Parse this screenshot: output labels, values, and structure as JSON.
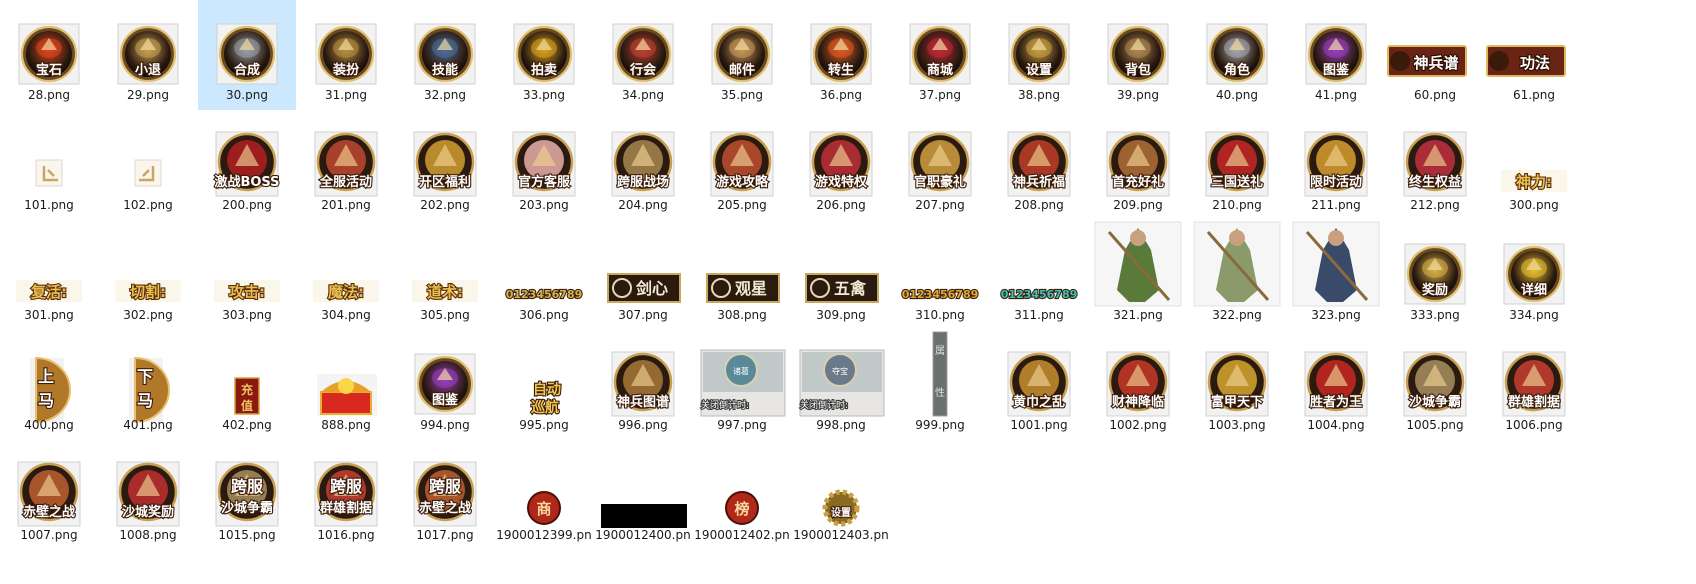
{
  "files": [
    {
      "name": "28.png",
      "kind": "round",
      "label": "宝石",
      "icon": "gem-flame-icon",
      "accent": "#e0461c"
    },
    {
      "name": "29.png",
      "kind": "round",
      "label": "小退",
      "icon": "hourglass-icon",
      "accent": "#c8a050"
    },
    {
      "name": "30.png",
      "kind": "round",
      "label": "合成",
      "icon": "anvil-hammer-icon",
      "accent": "#9aa0a8",
      "selected": true
    },
    {
      "name": "31.png",
      "kind": "round",
      "label": "装扮",
      "icon": "armor-icon",
      "accent": "#b89040"
    },
    {
      "name": "32.png",
      "kind": "round",
      "label": "技能",
      "icon": "skill-book-icon",
      "accent": "#4f6e9a"
    },
    {
      "name": "33.png",
      "kind": "round",
      "label": "拍卖",
      "icon": "auction-hammer-icon",
      "accent": "#d8a020"
    },
    {
      "name": "34.png",
      "kind": "round",
      "label": "行会",
      "icon": "guild-crest-icon",
      "accent": "#c04030"
    },
    {
      "name": "35.png",
      "kind": "round",
      "label": "邮件",
      "icon": "mail-scroll-icon",
      "accent": "#c89858"
    },
    {
      "name": "36.png",
      "kind": "round",
      "label": "转生",
      "icon": "rebirth-flame-icon",
      "accent": "#e05a20"
    },
    {
      "name": "37.png",
      "kind": "round",
      "label": "商城",
      "icon": "shop-mask-icon",
      "accent": "#c02838"
    },
    {
      "name": "38.png",
      "kind": "round",
      "label": "设置",
      "icon": "settings-bagua-icon",
      "accent": "#c8a040"
    },
    {
      "name": "39.png",
      "kind": "round",
      "label": "背包",
      "icon": "backpack-icon",
      "accent": "#b08850"
    },
    {
      "name": "40.png",
      "kind": "round",
      "label": "角色",
      "icon": "character-swords-icon",
      "accent": "#a8a8b0"
    },
    {
      "name": "41.png",
      "kind": "round",
      "label": "图鉴",
      "icon": "codex-book-icon",
      "accent": "#9a3ec0"
    },
    {
      "name": "60.png",
      "kind": "banner",
      "label": "神兵谱",
      "icon": "divine-weapon-banner-icon",
      "accent": "#6a2414"
    },
    {
      "name": "61.png",
      "kind": "banner",
      "label": "功法",
      "icon": "meditation-banner-icon",
      "accent": "#6a2414"
    },
    {
      "name": "101.png",
      "kind": "corner",
      "label": "",
      "icon": "corner-frame-left-icon",
      "accent": "#c8a860"
    },
    {
      "name": "102.png",
      "kind": "corner",
      "label": "",
      "icon": "corner-frame-right-icon",
      "accent": "#c8a860"
    },
    {
      "name": "200.png",
      "kind": "event",
      "label": "激战BOSS",
      "icon": "boss-demon-icon",
      "accent": "#b02020"
    },
    {
      "name": "201.png",
      "kind": "event",
      "label": "全服活动",
      "icon": "server-event-icon",
      "accent": "#c04830"
    },
    {
      "name": "202.png",
      "kind": "event",
      "label": "开区福利",
      "icon": "golden-pig-icon",
      "accent": "#d0a030"
    },
    {
      "name": "203.png",
      "kind": "event",
      "label": "官方客服",
      "icon": "support-girl-icon",
      "accent": "#e8b0a8"
    },
    {
      "name": "204.png",
      "kind": "event",
      "label": "跨服战场",
      "icon": "cross-server-gate-icon",
      "accent": "#a88850"
    },
    {
      "name": "205.png",
      "kind": "event",
      "label": "游戏攻略",
      "icon": "strategy-shield-icon",
      "accent": "#c05030"
    },
    {
      "name": "206.png",
      "kind": "event",
      "label": "游戏特权",
      "icon": "privilege-crown-icon",
      "accent": "#c03038"
    },
    {
      "name": "207.png",
      "kind": "event",
      "label": "官职豪礼",
      "icon": "rank-crown-icon",
      "accent": "#d0a040"
    },
    {
      "name": "208.png",
      "kind": "event",
      "label": "神兵祈福",
      "icon": "divine-blade-icon",
      "accent": "#c04028"
    },
    {
      "name": "209.png",
      "kind": "event",
      "label": "首充好礼",
      "icon": "first-recharge-bag-icon",
      "accent": "#b07038"
    },
    {
      "name": "210.png",
      "kind": "event",
      "label": "三国送礼",
      "icon": "treasure-chest-icon",
      "accent": "#c82828"
    },
    {
      "name": "211.png",
      "kind": "event",
      "label": "限时活动",
      "icon": "limited-chest-icon",
      "accent": "#d8a030"
    },
    {
      "name": "212.png",
      "kind": "event",
      "label": "终生权益",
      "icon": "lifetime-chest-icon",
      "accent": "#c03040"
    },
    {
      "name": "300.png",
      "kind": "goldtext",
      "label": "神力:",
      "icon": "",
      "accent": "#e8c050"
    },
    {
      "name": "301.png",
      "kind": "goldtext",
      "label": "复活:",
      "icon": "",
      "accent": "#e8c050"
    },
    {
      "name": "302.png",
      "kind": "goldtext",
      "label": "切割:",
      "icon": "",
      "accent": "#e8c050"
    },
    {
      "name": "303.png",
      "kind": "goldtext",
      "label": "攻击:",
      "icon": "",
      "accent": "#e8c050"
    },
    {
      "name": "304.png",
      "kind": "goldtext",
      "label": "魔法:",
      "icon": "",
      "accent": "#e8c050"
    },
    {
      "name": "305.png",
      "kind": "goldtext",
      "label": "道术:",
      "icon": "",
      "accent": "#e8c050"
    },
    {
      "name": "306.png",
      "kind": "digits",
      "label": "0123456789",
      "icon": "",
      "accent": "#d8b050"
    },
    {
      "name": "307.png",
      "kind": "plaque",
      "label": "剑心",
      "icon": "sword-heart-emblem-icon",
      "accent": "#2a1a10"
    },
    {
      "name": "308.png",
      "kind": "plaque",
      "label": "观星",
      "icon": "star-gazing-emblem-icon",
      "accent": "#2a1a10"
    },
    {
      "name": "309.png",
      "kind": "plaque",
      "label": "五禽",
      "icon": "five-beasts-emblem-icon",
      "accent": "#2a1a10"
    },
    {
      "name": "310.png",
      "kind": "digits",
      "label": "0123456789",
      "icon": "",
      "accent": "#e0a838"
    },
    {
      "name": "311.png",
      "kind": "digits",
      "label": "0123456789",
      "icon": "",
      "accent": "#40c0c0"
    },
    {
      "name": "321.png",
      "kind": "figure",
      "label": "",
      "icon": "green-warrior-icon",
      "accent": "#5a7a3a"
    },
    {
      "name": "322.png",
      "kind": "figure",
      "label": "",
      "icon": "griffin-mount-icon",
      "accent": "#8a9a6a"
    },
    {
      "name": "323.png",
      "kind": "figure",
      "label": "",
      "icon": "armored-general-icon",
      "accent": "#3a4a6a"
    },
    {
      "name": "333.png",
      "kind": "round",
      "label": "奖励",
      "icon": "gift-box-icon",
      "accent": "#d8b048"
    },
    {
      "name": "334.png",
      "kind": "round",
      "label": "详细",
      "icon": "question-mark-icon",
      "accent": "#e8c030"
    },
    {
      "name": "400.png",
      "kind": "halfcoin",
      "label": "上马",
      "icon": "mount-up-icon",
      "accent": "#b07828"
    },
    {
      "name": "401.png",
      "kind": "halfcoin",
      "label": "下马",
      "icon": "mount-down-icon",
      "accent": "#b07828"
    },
    {
      "name": "402.png",
      "kind": "recharge",
      "label": "充值",
      "icon": "recharge-tag-icon",
      "accent": "#8a1a10"
    },
    {
      "name": "888.png",
      "kind": "chest",
      "label": "",
      "icon": "gold-treasure-chest-icon",
      "accent": "#d82820"
    },
    {
      "name": "994.png",
      "kind": "round",
      "label": "图鉴",
      "icon": "codex-book-icon",
      "accent": "#9a3ec0"
    },
    {
      "name": "995.png",
      "kind": "autonav",
      "label": "自动巡航",
      "icon": "",
      "accent": "#e8c050"
    },
    {
      "name": "996.png",
      "kind": "event",
      "label": "神兵图谱",
      "icon": "divine-weapon-codex-icon",
      "accent": "#a87838"
    },
    {
      "name": "997.png",
      "kind": "panel",
      "label": "关闭倒计时:",
      "icon": "sanctuary-icon",
      "accent": "#5a8a9a",
      "badge": "诸葛"
    },
    {
      "name": "998.png",
      "kind": "panel",
      "label": "关闭倒计时:",
      "icon": "battle-scene-icon",
      "accent": "#6a7a8a",
      "badge": "夺宝"
    },
    {
      "name": "999.png",
      "kind": "vbar",
      "label": "属性",
      "icon": "attribute-tab-icon",
      "accent": "#6a7070"
    },
    {
      "name": "1001.png",
      "kind": "event",
      "label": "黄巾之乱",
      "icon": "yellow-turban-icon",
      "accent": "#c89030"
    },
    {
      "name": "1002.png",
      "kind": "event",
      "label": "财神降临",
      "icon": "god-of-wealth-icon",
      "accent": "#c83828"
    },
    {
      "name": "1003.png",
      "kind": "event",
      "label": "富甲天下",
      "icon": "gold-cauldron-icon",
      "accent": "#d8a830"
    },
    {
      "name": "1004.png",
      "kind": "event",
      "label": "胜者为王",
      "icon": "victory-red-envelope-icon",
      "accent": "#c82820"
    },
    {
      "name": "1005.png",
      "kind": "event",
      "label": "沙城争霸",
      "icon": "castle-siege-icon",
      "accent": "#a89060"
    },
    {
      "name": "1006.png",
      "kind": "event",
      "label": "群雄割据",
      "icon": "warlords-icon",
      "accent": "#c84030"
    },
    {
      "name": "1007.png",
      "kind": "event",
      "label": "赤壁之战",
      "icon": "red-cliff-ship-icon",
      "accent": "#c06030"
    },
    {
      "name": "1008.png",
      "kind": "event",
      "label": "沙城奖励",
      "icon": "siege-reward-icon",
      "accent": "#c03030"
    },
    {
      "name": "1015.png",
      "kind": "event2",
      "label": "沙城争霸",
      "sub": "跨服",
      "icon": "castle-siege-icon",
      "accent": "#a89060"
    },
    {
      "name": "1016.png",
      "kind": "event2",
      "label": "群雄割据",
      "sub": "跨服",
      "icon": "warlords-icon",
      "accent": "#c84030"
    },
    {
      "name": "1017.png",
      "kind": "event2",
      "label": "赤壁之战",
      "sub": "跨服",
      "icon": "red-cliff-ship-icon",
      "accent": "#c06030"
    },
    {
      "name": "1900012399.pn",
      "kind": "seal",
      "label": "商",
      "icon": "shop-seal-icon",
      "accent": "#b02818"
    },
    {
      "name": "1900012400.pn",
      "kind": "blackbar",
      "label": "",
      "icon": "",
      "accent": "#000000"
    },
    {
      "name": "1900012402.pn",
      "kind": "seal",
      "label": "榜",
      "icon": "ranking-seal-icon",
      "accent": "#b02818"
    },
    {
      "name": "1900012403.pn",
      "kind": "gear",
      "label": "设置",
      "icon": "settings-gear-icon",
      "accent": "#c8a040"
    }
  ]
}
